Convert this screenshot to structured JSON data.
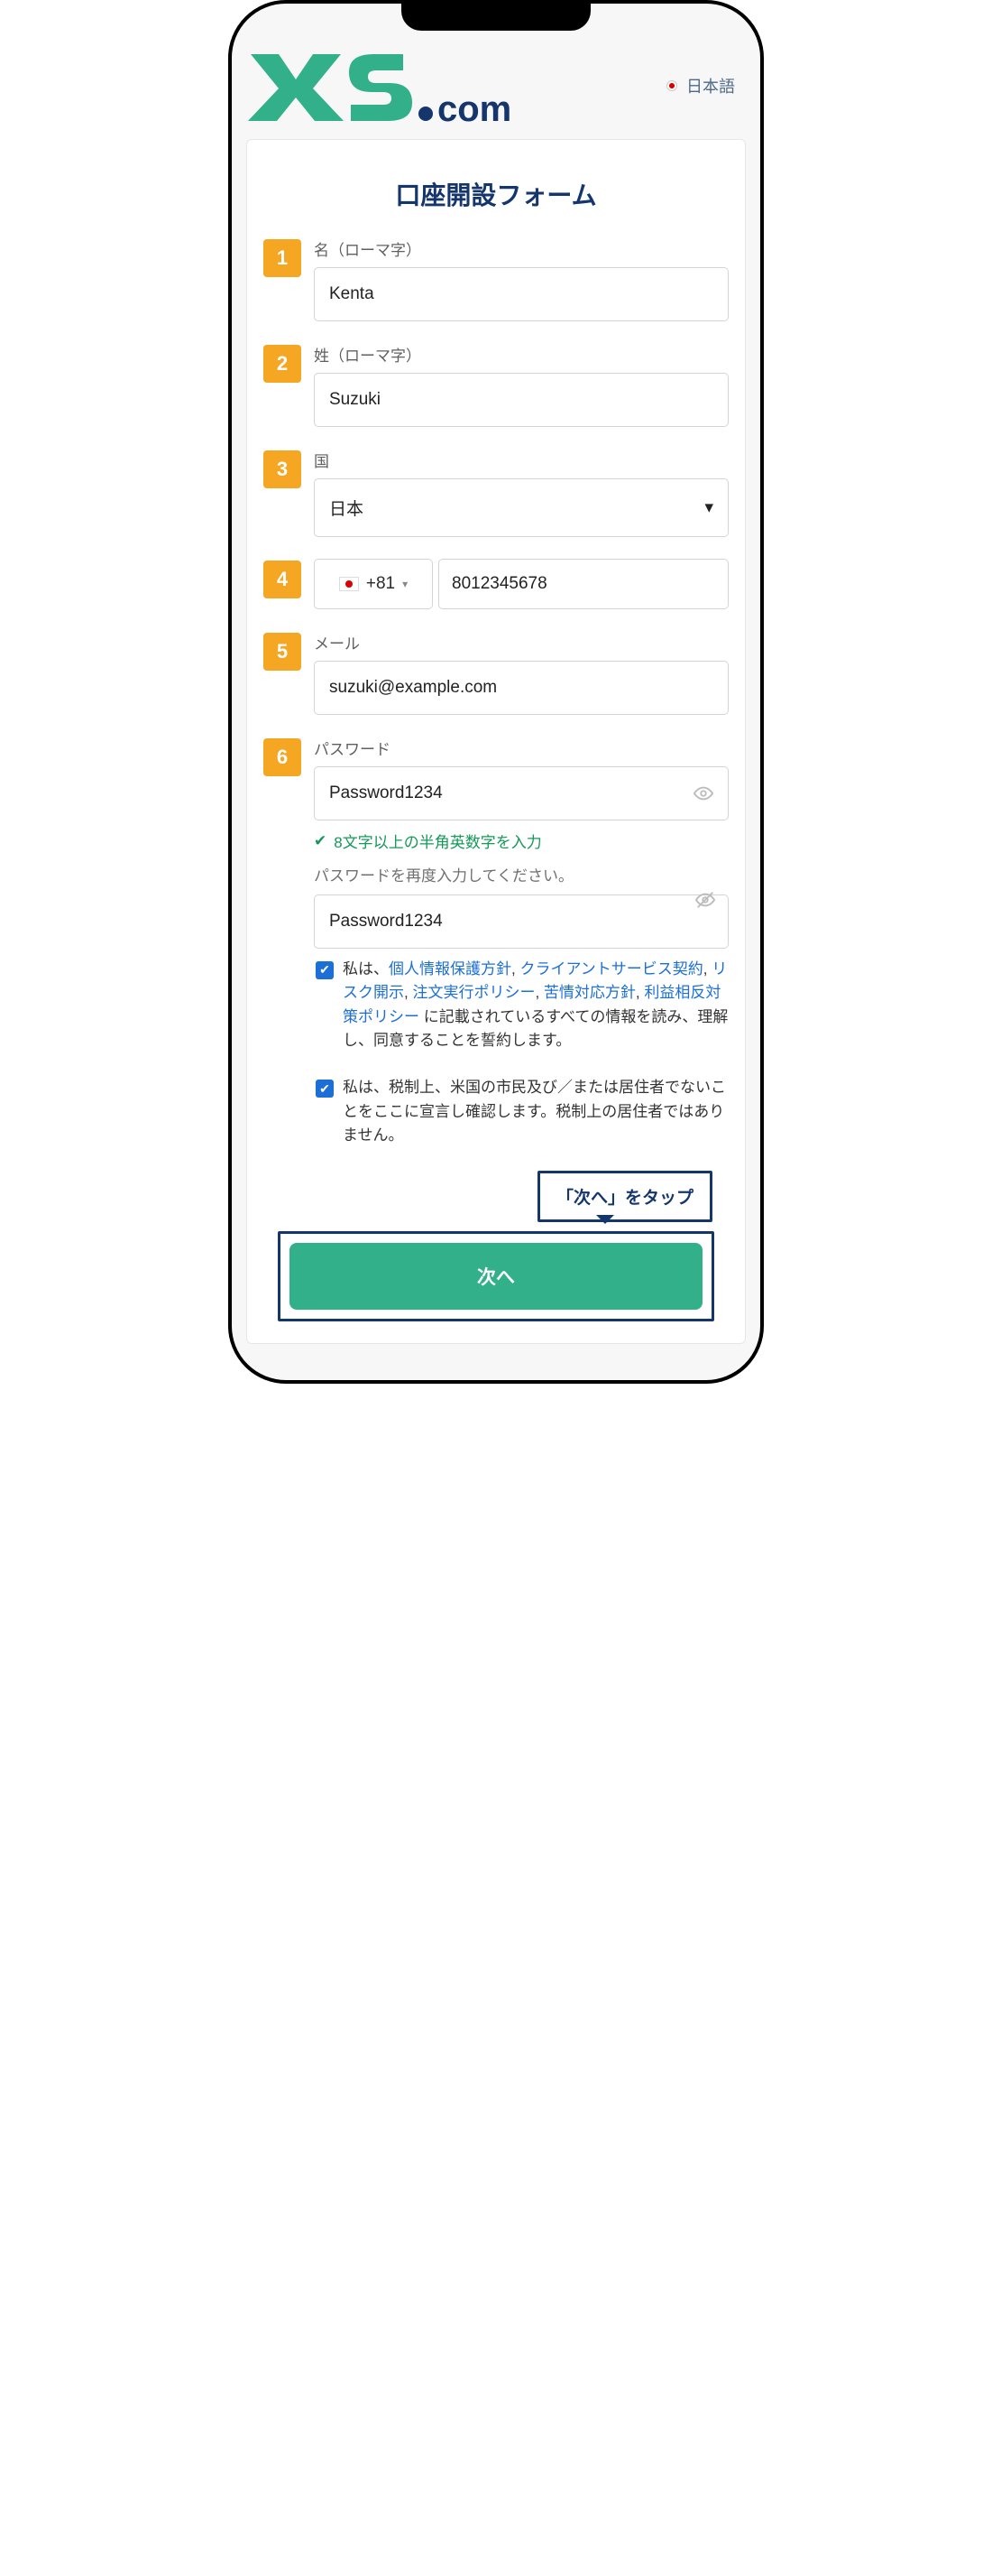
{
  "header": {
    "lang_label": "日本語"
  },
  "form": {
    "title": "口座開設フォーム",
    "fields": {
      "first_name": {
        "num": "1",
        "label": "名（ローマ字）",
        "value": "Kenta"
      },
      "last_name": {
        "num": "2",
        "label": "姓（ローマ字）",
        "value": "Suzuki"
      },
      "country": {
        "num": "3",
        "label": "国",
        "value": "日本"
      },
      "phone": {
        "num": "4",
        "code": "+81",
        "number": "8012345678"
      },
      "email": {
        "num": "5",
        "label": "メール",
        "value": "suzuki@example.com"
      },
      "password": {
        "num": "6",
        "label": "パスワード",
        "value": "Password1234",
        "hint_ok": "8文字以上の半角英数字を入力",
        "hint_confirm": "パスワードを再度入力してください。",
        "confirm_value": "Password1234"
      }
    },
    "consent1": {
      "pre": "私は、",
      "links": [
        "個人情報保護方針",
        "クライアントサービス契約",
        "リスク開示",
        "注文実行ポリシー",
        "苦情対応方針",
        "利益相反対策ポリシー"
      ],
      "post": " に記載されているすべての情報を読み、理解し、同意することを誓約します。"
    },
    "consent2": "私は、税制上、米国の市民及び／または居住者でないことをここに宣言し確認します。税制上の居住者ではありません。",
    "callout": "「次へ」をタップ",
    "submit": "次へ"
  }
}
